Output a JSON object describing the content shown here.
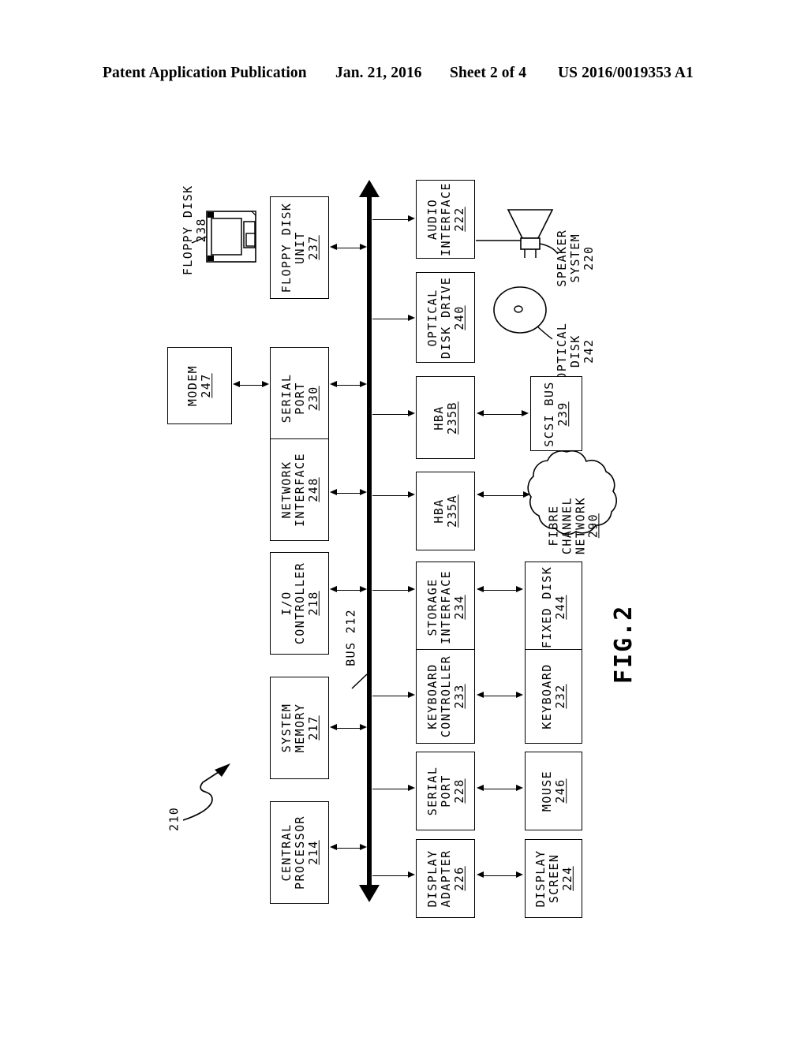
{
  "header": {
    "title": "Patent Application Publication",
    "date": "Jan. 21, 2016",
    "sheet": "Sheet 2 of 4",
    "patent_number": "US 2016/0019353 A1"
  },
  "figure": {
    "label": "FIG.2",
    "system_ref": "210",
    "bus_label": "BUS 212"
  },
  "blocks": {
    "floppy_disk_unit": {
      "name": "FLOPPY DISK\nUNIT",
      "line1": "FLOPPY DISK",
      "line2": "UNIT",
      "num": "237"
    },
    "serial_port_230": {
      "line1": "SERIAL",
      "line2": "PORT",
      "num": "230"
    },
    "network_interface": {
      "line1": "NETWORK",
      "line2": "INTERFACE",
      "num": "248"
    },
    "io_controller": {
      "line1": "I/O",
      "line2": "CONTROLLER",
      "num": "218"
    },
    "system_memory": {
      "line1": "SYSTEM",
      "line2": "MEMORY",
      "num": "217"
    },
    "central_processor": {
      "line1": "CENTRAL",
      "line2": "PROCESSOR",
      "num": "214"
    },
    "modem": {
      "line1": "MODEM",
      "line2": "",
      "num": "247"
    },
    "audio_interface": {
      "line1": "AUDIO",
      "line2": "INTERFACE",
      "num": "222"
    },
    "optical_disk_drive": {
      "line1": "OPTICAL",
      "line2": "DISK DRIVE",
      "num": "240"
    },
    "hba_235b": {
      "line1": "HBA",
      "line2": "",
      "num": "235B"
    },
    "hba_235a": {
      "line1": "HBA",
      "line2": "",
      "num": "235A"
    },
    "storage_interface": {
      "line1": "STORAGE",
      "line2": "INTERFACE",
      "num": "234"
    },
    "keyboard_controller": {
      "line1": "KEYBOARD",
      "line2": "CONTROLLER",
      "num": "233"
    },
    "serial_port_228": {
      "line1": "SERIAL",
      "line2": "PORT",
      "num": "228"
    },
    "display_adapter": {
      "line1": "DISPLAY",
      "line2": "ADAPTER",
      "num": "226"
    },
    "scsi_bus": {
      "line1": "SCSI BUS",
      "line2": "",
      "num": "239"
    },
    "fixed_disk": {
      "line1": "FIXED DISK",
      "line2": "",
      "num": "244"
    },
    "keyboard": {
      "line1": "KEYBOARD",
      "line2": "",
      "num": "232"
    },
    "mouse": {
      "line1": "MOUSE",
      "line2": "",
      "num": "246"
    },
    "display_screen": {
      "line1": "DISPLAY",
      "line2": "SCREEN",
      "num": "224"
    }
  },
  "callouts": {
    "floppy_disk": {
      "line1": "FLOPPY DISK",
      "line2": "",
      "num": "238"
    },
    "speaker_system": {
      "line1": "SPEAKER",
      "line2": "SYSTEM",
      "num": "220"
    },
    "optical_disk": {
      "line1": "OPTICAL",
      "line2": "DISK",
      "num": "242"
    },
    "fibre_channel": {
      "line1": "FIBRE",
      "line2": "CHANNEL",
      "line3": "NETWORK",
      "num": "290"
    }
  }
}
